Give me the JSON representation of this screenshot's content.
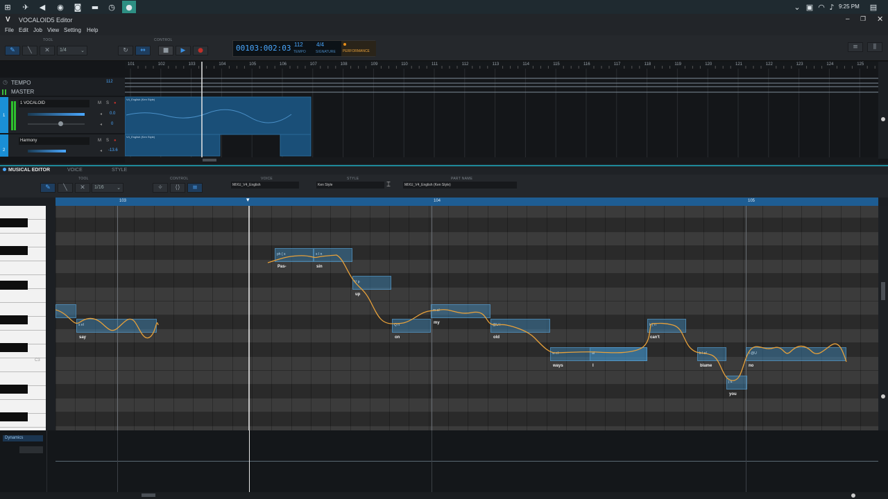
{
  "taskbar": {
    "time": "9:25 PM"
  },
  "window": {
    "title": "VOCALOID5 Editor",
    "logo": "V"
  },
  "menu": [
    "File",
    "Edit",
    "Job",
    "View",
    "Setting",
    "Help"
  ],
  "toolbar": {
    "tool_label": "TOOL",
    "quantize": "1/4",
    "control_label": "CONTROL",
    "position": "00103:002:03",
    "tempo_value": "112",
    "tempo_label": "TEMPO",
    "signature_value": "4/4",
    "signature_label": "SIGNATURE",
    "performance_label": "PERFORMANCE"
  },
  "arranger": {
    "bars": [
      "101",
      "102",
      "103",
      "104",
      "105",
      "106",
      "107",
      "108",
      "109",
      "110",
      "111",
      "112",
      "113",
      "114",
      "115",
      "116",
      "117",
      "118",
      "119",
      "120",
      "121",
      "122",
      "123",
      "124",
      "125"
    ],
    "tempo_track_label": "TEMPO",
    "tempo_track_value": "112",
    "master_label": "MASTER",
    "tracks": [
      {
        "number": "1",
        "name": "1 VOCALOID",
        "vol": "0.0",
        "pan": "0",
        "part": "V4_English (Ken Style)"
      },
      {
        "number": "2",
        "name": "Harmony",
        "vol": "-13.6",
        "part": "V4_English (Ken Style)"
      }
    ],
    "mute": "M",
    "solo": "S"
  },
  "musical_editor": {
    "tabs": [
      "MUSICAL EDITOR",
      "VOICE",
      "STYLE"
    ],
    "tool_label": "TOOL",
    "quantize": "1/16",
    "control_label": "CONTROL",
    "voice_label": "VOICE",
    "voice_value": "MIXU_V4_English",
    "style_label": "STYLE",
    "style_value": "Ken Style",
    "part_name_label": "PART NAME",
    "part_name_value": "MIXU_V4_English (Ken Style)",
    "bars": [
      "103",
      "104",
      "105"
    ],
    "c_label": "C3",
    "notes": [
      {
        "lyric": "say",
        "phon": "s eI"
      },
      {
        "lyric": "Pas-",
        "phon": "ph { s"
      },
      {
        "lyric": "sin",
        "phon": "s I n"
      },
      {
        "lyric": "up",
        "phon": "V p"
      },
      {
        "lyric": "on",
        "phon": "Q n"
      },
      {
        "lyric": "my",
        "phon": "m aI"
      },
      {
        "lyric": "old",
        "phon": "@U l"
      },
      {
        "lyric": "ways",
        "phon": "w eI"
      },
      {
        "lyric": "I",
        "phon": "aI"
      },
      {
        "lyric": "can't",
        "phon": "k { n"
      },
      {
        "lyric": "blame",
        "phon": "b l eI"
      },
      {
        "lyric": "you",
        "phon": "j u:"
      },
      {
        "lyric": "no",
        "phon": "n @U"
      }
    ],
    "dynamics_label": "Dynamics"
  },
  "colors": {
    "accent": "#1e8a9a",
    "note": "#408cbe",
    "pitch": "#e8a13a",
    "ruler": "#1e5d93"
  }
}
